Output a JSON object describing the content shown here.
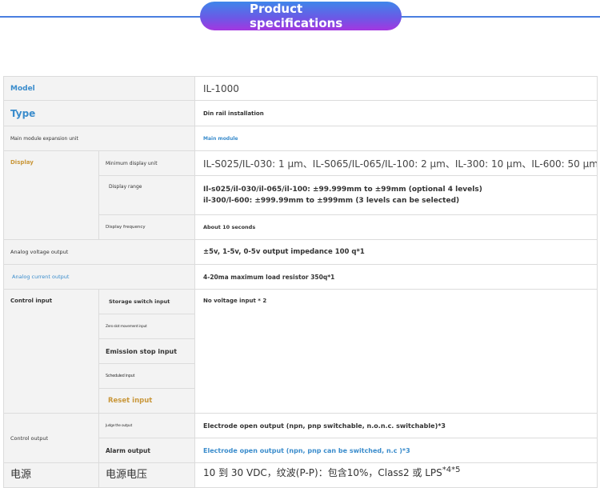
{
  "header": {
    "title_line1": "Product",
    "title_line2": "specifications",
    "accent": "#4a7fe0"
  },
  "rows": {
    "model": {
      "label": "Model",
      "value": "IL-1000"
    },
    "type": {
      "label": "Type",
      "value": "Din rail installation"
    },
    "expansion": {
      "label": "Main module expansion unit",
      "value": "Main module"
    },
    "display": {
      "label": "Display",
      "min_unit_label": "Minimum display unit",
      "min_unit_value": "IL-S025/IL-030: 1 μm、IL-S065/IL-065/IL-100: 2 μm、IL-300: 10 μm、IL-600: 50 μm",
      "range_label": "Display range",
      "range_value_1": "Il-s025/il-030/il-065/il-100: ±99.999mm to ±99mm (optional 4 levels)",
      "range_value_2": "il-300/l-600: ±999.99mm to ±999mm (3 levels can be selected)",
      "freq_label": "Display frequency",
      "freq_value": "About 10 seconds"
    },
    "analog_voltage": {
      "label": "Analog voltage output",
      "value": "±5v, 1-5v, 0-5v output impedance 100 q*1"
    },
    "analog_current": {
      "label": "Analog current output",
      "value": "4-20ma maximum load resistor 350q*1"
    },
    "control_input": {
      "label": "Control input",
      "items": [
        "Storage switch input",
        "Zero slot movement input",
        "Emission stop input",
        "Scheduled input",
        "Reset input"
      ],
      "value": "No voltage input * 2"
    },
    "control_output": {
      "label": "Control output",
      "judge_label": "Judge the output",
      "judge_value": "Electrode open output (npn, pnp switchable, n.o.n.c. switchable)*3",
      "alarm_label": "Alarm output",
      "alarm_value": "Electrode open output (npn, pnp can be switched, n.c )*3"
    },
    "power": {
      "label": "电源",
      "sub_label": "电源电压",
      "value": "10 到 30 VDC，纹波(P-P)：包含10%，Class2 或 LPS",
      "note": "*4*5"
    }
  }
}
